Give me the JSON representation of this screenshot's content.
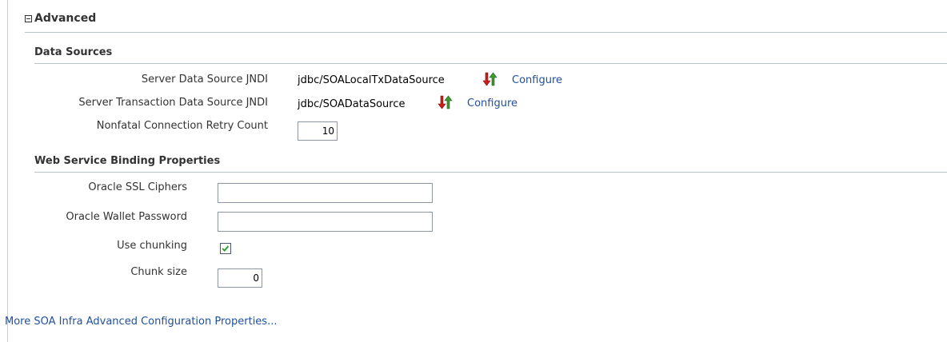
{
  "section": {
    "title": "Advanced"
  },
  "data_sources": {
    "heading": "Data Sources",
    "rows": [
      {
        "label": "Server Data Source JNDI",
        "value": "jdbc/SOALocalTxDataSource",
        "link": "Configure"
      },
      {
        "label": "Server Transaction Data Source JNDI",
        "value": "jdbc/SOADataSource",
        "link": "Configure"
      }
    ],
    "retry": {
      "label": "Nonfatal Connection Retry Count",
      "value": "10"
    }
  },
  "ws_binding": {
    "heading": "Web Service Binding Properties",
    "ssl_ciphers": {
      "label": "Oracle SSL Ciphers",
      "value": ""
    },
    "wallet_password": {
      "label": "Oracle Wallet Password",
      "value": ""
    },
    "use_chunking": {
      "label": "Use chunking",
      "checked": true
    },
    "chunk_size": {
      "label": "Chunk size",
      "value": "0"
    }
  },
  "more_link": "More SOA Infra Advanced Configuration Properties...",
  "colors": {
    "link": "#1f4f9f",
    "rule": "#b9c2cc",
    "check": "#2e9e2e",
    "arrow_red": "#d11a1a",
    "arrow_green": "#3a9a2a"
  },
  "icons": {
    "toggle": "collapse-minus-icon",
    "refresh": "refresh-arrows-icon",
    "check": "checkmark-icon"
  }
}
